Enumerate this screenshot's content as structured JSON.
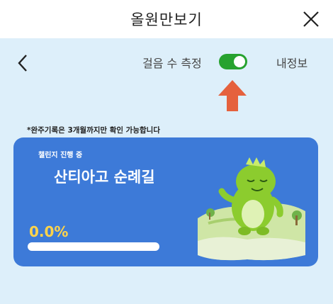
{
  "header": {
    "title": "올원만보기"
  },
  "toolbar": {
    "step_label": "걸음 수 측정",
    "step_toggle_on": true,
    "my_info_label": "내정보"
  },
  "notice": "*완주기록은 3개월까지만 확인 가능합니다",
  "challenge": {
    "status_tag": "챌린지 진행 중",
    "name": "산티아고 순례길",
    "progress_text": "0.0%",
    "progress": 0.0
  },
  "colors": {
    "background": "#ddeffa",
    "card": "#3d7ad8",
    "toggle_on": "#27a22f",
    "arrow": "#e5613d",
    "progress_text": "#ffd34a"
  },
  "icons": {
    "close": "close-icon",
    "back": "chevron-left-icon",
    "pointer": "up-arrow-icon",
    "mascot": "green-dinosaur-mascot"
  }
}
